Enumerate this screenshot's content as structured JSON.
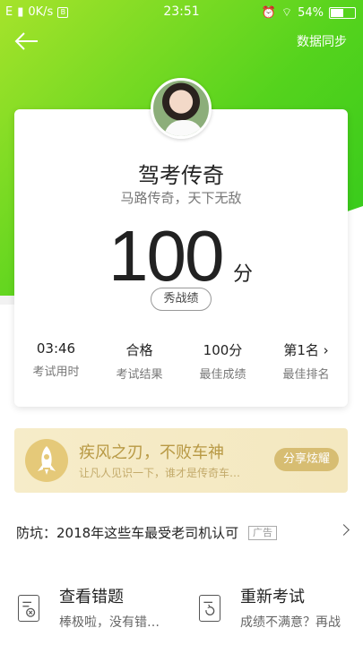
{
  "status_bar": {
    "network": "E",
    "speed": "0K/s",
    "time": "23:51",
    "battery": "54%"
  },
  "header": {
    "sync_label": "数据同步"
  },
  "result_card": {
    "title": "驾考传奇",
    "subtitle": "马路传奇，天下无敌",
    "score": "100",
    "score_unit": "分",
    "show_button": "秀战绩",
    "stats": [
      {
        "value": "03:46",
        "label": "考试用时"
      },
      {
        "value": "合格",
        "label": "考试结果"
      },
      {
        "value": "100分",
        "label": "最佳成绩"
      },
      {
        "value": "第1名",
        "label": "最佳排名"
      }
    ]
  },
  "banner": {
    "title": "疾风之刃，不败车神",
    "subtitle": "让凡人见识一下，谁才是传奇车…",
    "share_label": "分享炫耀"
  },
  "ad": {
    "text": "防坑：2018年这些车最受老司机认可",
    "tag": "广告"
  },
  "actions": [
    {
      "title": "查看错题",
      "subtitle": "棒极啦，没有错…"
    },
    {
      "title": "重新考试",
      "subtitle": "成绩不满意？再战"
    }
  ]
}
